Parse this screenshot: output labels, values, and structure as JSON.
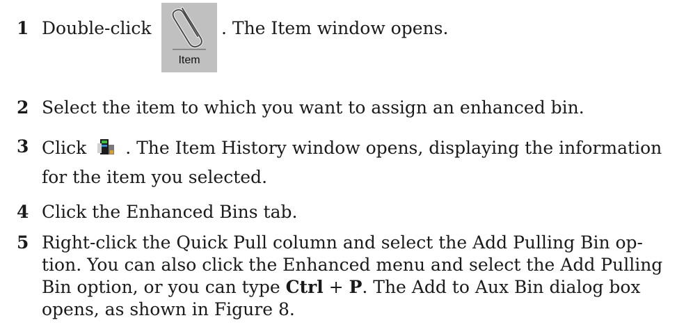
{
  "steps": [
    {
      "number": "1",
      "before_icon": "Double-click",
      "icon_label": "Item",
      "after_icon": ". The Item window opens."
    },
    {
      "number": "2",
      "text": "Select the item to which you want to assign an enhanced bin."
    },
    {
      "number": "3",
      "before_icon": "Click",
      "after_icon": ". The Item History window opens, displaying the information",
      "line2": "for the item you selected."
    },
    {
      "number": "4",
      "text": "Click the Enhanced Bins tab."
    },
    {
      "number": "5",
      "line1": "Right-click the Quick Pull column and select the Add Pulling Bin op-",
      "line2": "tion. You can also click the Enhanced menu and select the Add Pulling",
      "line3_a": "Bin option, or you can type ",
      "line3_ctrl": "Ctrl",
      "line3_plus": " + ",
      "line3_p": "P",
      "line3_b": ". The Add to Aux Bin dialog box",
      "line4": "opens, as shown in Figure 8."
    }
  ],
  "icons": {
    "item_toolbar_icon": "paperclip-icon",
    "item_history_icon": "item-history-icon"
  }
}
